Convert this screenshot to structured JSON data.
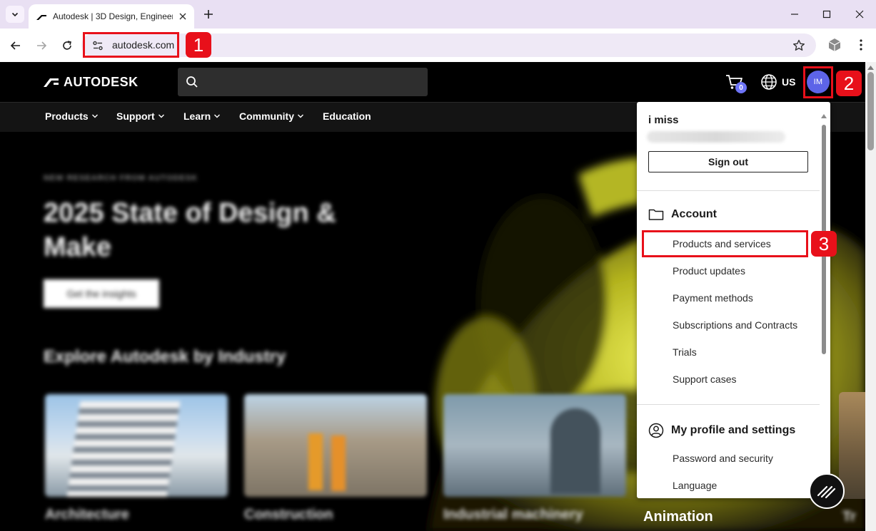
{
  "browser": {
    "tab_title": "Autodesk | 3D Design, Engineering & Construction Software",
    "url": "autodesk.com"
  },
  "site": {
    "logo_text": "AUTODESK",
    "cart_count": "0",
    "region": "US",
    "avatar_initials": "IM",
    "nav": [
      "Products",
      "Support",
      "Learn",
      "Community",
      "Education"
    ]
  },
  "hero": {
    "eyebrow": "NEW RESEARCH FROM AUTODESK",
    "title": "2025 State of Design & Make",
    "cta": "Get the insights",
    "section_title": "Explore Autodesk by Industry",
    "cards": [
      "Architecture",
      "Construction",
      "Industrial machinery"
    ],
    "animation_label": "Animation",
    "tr_label": "Tr"
  },
  "dropdown": {
    "user_name": "i miss",
    "sign_out": "Sign out",
    "account_heading": "Account",
    "account_items": [
      "Products and services",
      "Product updates",
      "Payment methods",
      "Subscriptions and Contracts",
      "Trials",
      "Support cases"
    ],
    "profile_heading": "My profile and settings",
    "profile_items": [
      "Password and security",
      "Language"
    ]
  },
  "annotations": [
    "1",
    "2",
    "3"
  ],
  "colors": {
    "accent_avatar": "#5d64e8",
    "annotation_red": "#e8101a"
  }
}
